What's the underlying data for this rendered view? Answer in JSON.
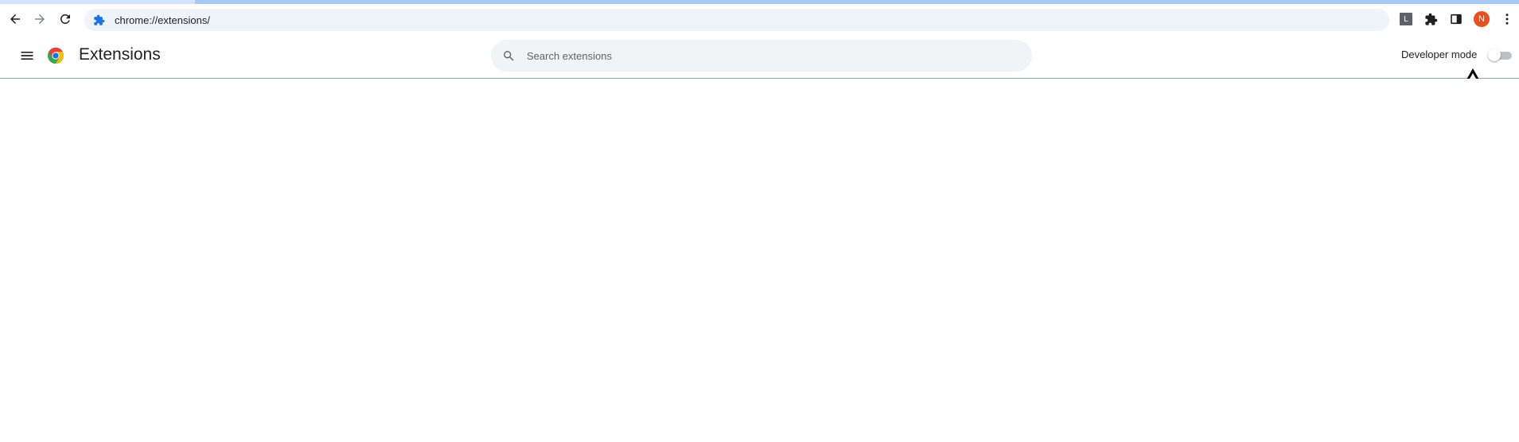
{
  "browser": {
    "address_bar": {
      "url": "chrome://extensions/"
    },
    "toolbar_icons": [
      "back-icon",
      "forward-icon",
      "reload-icon",
      "extension-l-icon",
      "puzzle-icon",
      "side-panel-icon",
      "profile-avatar",
      "more-vert-icon"
    ],
    "extension_badge_letter": "L",
    "profile_initial": "N"
  },
  "header": {
    "title": "Extensions",
    "search_placeholder": "Search extensions",
    "developer_mode_label": "Developer mode",
    "developer_mode_enabled": false
  },
  "colors": {
    "accent": "#1a73e8",
    "avatar": "#e8501d",
    "toggle_off": "#bdc1c6"
  }
}
